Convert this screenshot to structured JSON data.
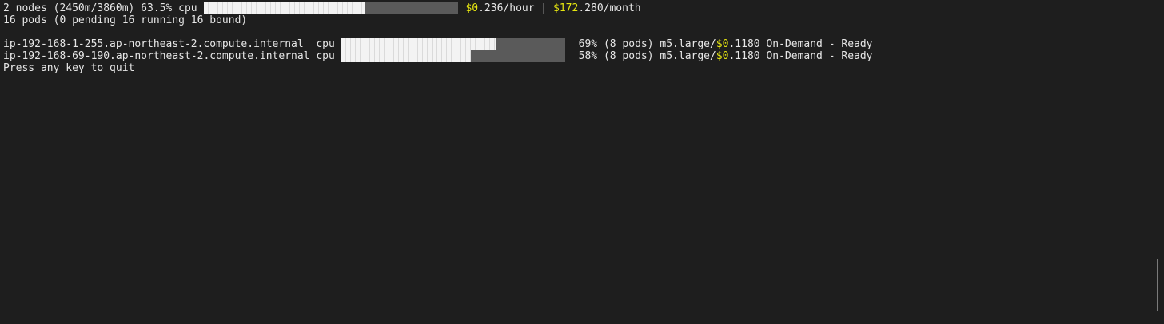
{
  "summary": {
    "nodes_text": "2 nodes (2450m/3860m) 63.5% cpu ",
    "cpu_fraction": 0.635,
    "dollar_sign": "$",
    "hour_dollars": "0",
    "hour_rest": ".236/hour | ",
    "month_dollars": "172",
    "month_rest": ".280/month",
    "pods_text": "16 pods (0 pending 16 running 16 bound)"
  },
  "nodes": [
    {
      "name_cpu": "ip-192-168-1-255.ap-northeast-2.compute.internal  cpu ",
      "cpu_fraction": 0.69,
      "pct_text": "69% (8 pods) m5.large/",
      "price_dollars": "0",
      "price_rest": ".1180 On-Demand - Ready"
    },
    {
      "name_cpu": "ip-192-168-69-190.ap-northeast-2.compute.internal cpu ",
      "cpu_fraction": 0.58,
      "pct_text": "58% (8 pods) m5.large/",
      "price_dollars": "0",
      "price_rest": ".1180 On-Demand - Ready"
    }
  ],
  "footer": {
    "quit_text": "Press any key to quit"
  },
  "colors": {
    "background": "#1e1e1e",
    "text": "#e6e6e6",
    "price_highlight": "#e5e510",
    "bar_fill": "#f3f3f3"
  }
}
